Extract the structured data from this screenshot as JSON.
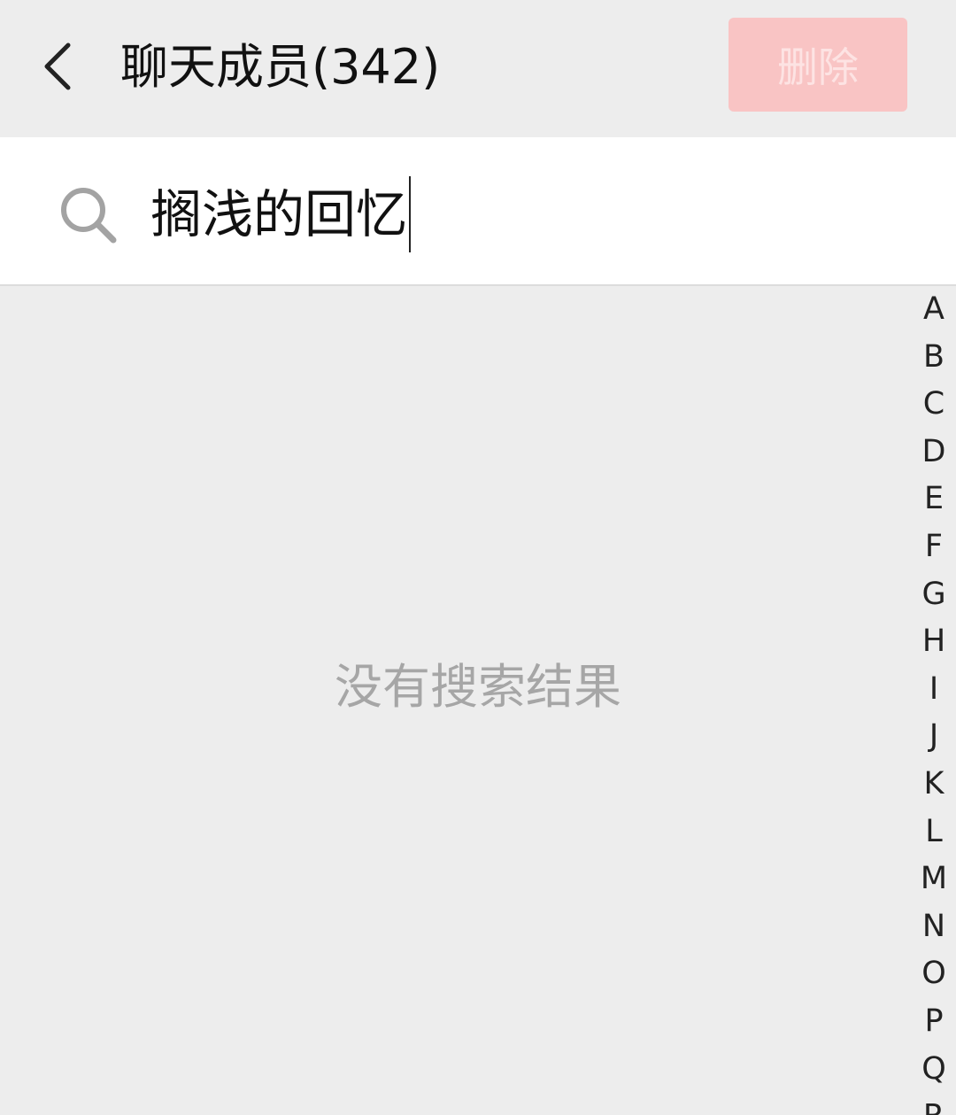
{
  "header": {
    "title": "聊天成员(342)",
    "delete_label": "删除"
  },
  "search": {
    "value": "搁浅的回忆",
    "icon": "search-icon"
  },
  "main": {
    "empty_message": "没有搜索结果"
  },
  "index_bar": {
    "letters": [
      "A",
      "B",
      "C",
      "D",
      "E",
      "F",
      "G",
      "H",
      "I",
      "J",
      "K",
      "L",
      "M",
      "N",
      "O",
      "P",
      "Q",
      "R"
    ]
  },
  "colors": {
    "background": "#ededed",
    "search_background": "#ffffff",
    "delete_disabled": "#f9c4c4",
    "empty_text": "#a6a6a6"
  }
}
